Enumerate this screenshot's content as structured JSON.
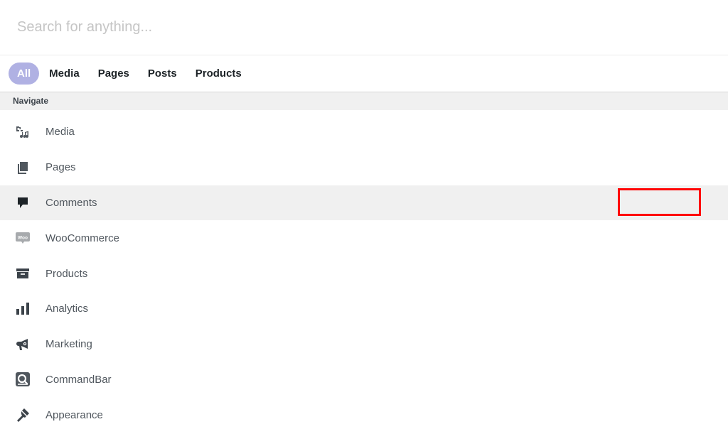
{
  "search": {
    "placeholder": "Search for anything...",
    "value": ""
  },
  "tabs": [
    {
      "label": "All",
      "active": true
    },
    {
      "label": "Media",
      "active": false
    },
    {
      "label": "Pages",
      "active": false
    },
    {
      "label": "Posts",
      "active": false
    },
    {
      "label": "Products",
      "active": false
    }
  ],
  "section": {
    "title": "Navigate"
  },
  "nav_items": [
    {
      "label": "Media",
      "icon": "media-icon"
    },
    {
      "label": "Pages",
      "icon": "pages-icon"
    },
    {
      "label": "Comments",
      "icon": "comment-icon",
      "highlighted": true
    },
    {
      "label": "WooCommerce",
      "icon": "woocommerce-icon"
    },
    {
      "label": "Products",
      "icon": "archive-box-icon"
    },
    {
      "label": "Analytics",
      "icon": "bar-chart-icon"
    },
    {
      "label": "Marketing",
      "icon": "megaphone-icon"
    },
    {
      "label": "CommandBar",
      "icon": "commandbar-icon"
    },
    {
      "label": "Appearance",
      "icon": "paint-brush-icon"
    }
  ],
  "colors": {
    "active_tab_bg": "#b0b1e3",
    "highlight_row_bg": "#f0f0f0",
    "annotation_box": "#ff0000"
  }
}
